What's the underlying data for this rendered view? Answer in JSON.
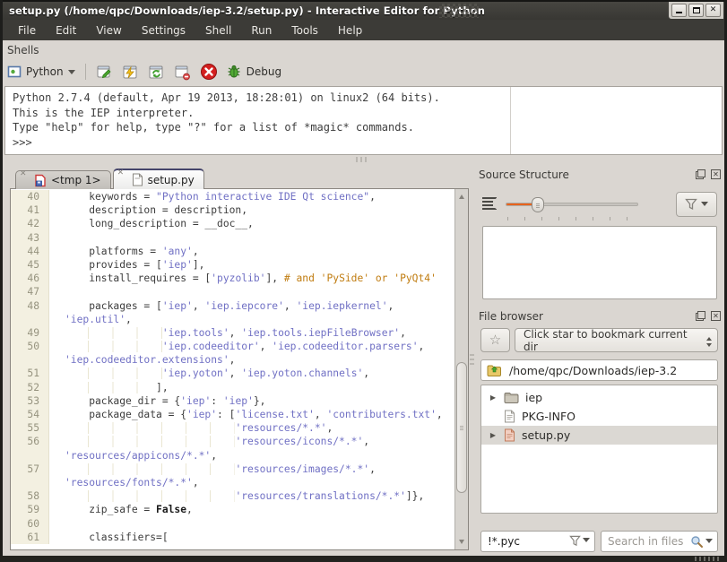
{
  "window": {
    "title": "setup.py (/home/qpc/Downloads/iep-3.2/setup.py) - Interactive Editor for Python",
    "controls": {
      "minimize": "minimize",
      "maximize": "maximize",
      "close": "x"
    }
  },
  "menu": {
    "items": [
      "File",
      "Edit",
      "View",
      "Settings",
      "Shell",
      "Run",
      "Tools",
      "Help"
    ]
  },
  "shells": {
    "label": "Shells",
    "toolbar": {
      "shell_button_label": "Python",
      "debug_label": "Debug"
    },
    "output_lines": [
      "Python 2.7.4 (default, Apr 19 2013, 18:28:01) on linux2 (64 bits).",
      "This is the IEP interpreter.",
      "Type \"help\" for help, type \"?\" for a list of *magic* commands.",
      ">>>"
    ]
  },
  "editor": {
    "tabs": [
      {
        "label": "<tmp 1>",
        "icon": "unsaved-file-icon",
        "active": false
      },
      {
        "label": "setup.py",
        "icon": "document-icon",
        "active": true
      }
    ],
    "lines": [
      {
        "n": "40",
        "s": [
          [
            "d",
            "    keywords = "
          ],
          [
            "s",
            "\"Python interactive IDE Qt science\""
          ],
          [
            "d",
            ","
          ]
        ]
      },
      {
        "n": "41",
        "s": [
          [
            "d",
            "    description = description,"
          ]
        ]
      },
      {
        "n": "42",
        "s": [
          [
            "d",
            "    long_description = __doc__,"
          ]
        ]
      },
      {
        "n": "43",
        "s": []
      },
      {
        "n": "44",
        "s": [
          [
            "d",
            "    platforms = "
          ],
          [
            "s",
            "'any'"
          ],
          [
            "d",
            ","
          ]
        ]
      },
      {
        "n": "45",
        "s": [
          [
            "d",
            "    provides = ["
          ],
          [
            "s",
            "'iep'"
          ],
          [
            "d",
            "],"
          ]
        ]
      },
      {
        "n": "46",
        "s": [
          [
            "d",
            "    install_requires = ["
          ],
          [
            "s",
            "'pyzolib'"
          ],
          [
            "d",
            "], "
          ],
          [
            "c",
            "# and 'PySide' or 'PyQt4'"
          ]
        ]
      },
      {
        "n": "47",
        "s": []
      },
      {
        "n": "48",
        "s": [
          [
            "d",
            "    packages = ["
          ],
          [
            "s",
            "'iep'"
          ],
          [
            "d",
            ", "
          ],
          [
            "s",
            "'iep.iepcore'"
          ],
          [
            "d",
            ", "
          ],
          [
            "s",
            "'iep.iepkernel'"
          ],
          [
            "d",
            ","
          ]
        ]
      },
      {
        "n": "",
        "s": [
          [
            "s",
            "'iep.util'"
          ],
          [
            "d",
            ","
          ]
        ]
      },
      {
        "n": "49",
        "s": [
          [
            "w",
            "                "
          ],
          [
            "s",
            "'iep.tools'"
          ],
          [
            "d",
            ", "
          ],
          [
            "s",
            "'iep.tools.iepFileBrowser'"
          ],
          [
            "d",
            ","
          ]
        ]
      },
      {
        "n": "50",
        "s": [
          [
            "w",
            "                "
          ],
          [
            "s",
            "'iep.codeeditor'"
          ],
          [
            "d",
            ", "
          ],
          [
            "s",
            "'iep.codeeditor.parsers'"
          ],
          [
            "d",
            ","
          ]
        ]
      },
      {
        "n": "",
        "s": [
          [
            "s",
            "'iep.codeeditor.extensions'"
          ],
          [
            "d",
            ","
          ]
        ]
      },
      {
        "n": "51",
        "s": [
          [
            "w",
            "                "
          ],
          [
            "s",
            "'iep.yoton'"
          ],
          [
            "d",
            ", "
          ],
          [
            "s",
            "'iep.yoton.channels'"
          ],
          [
            "d",
            ","
          ]
        ]
      },
      {
        "n": "52",
        "s": [
          [
            "w",
            "               "
          ],
          [
            "d",
            "],"
          ]
        ]
      },
      {
        "n": "53",
        "s": [
          [
            "d",
            "    package_dir = {"
          ],
          [
            "s",
            "'iep'"
          ],
          [
            "d",
            ": "
          ],
          [
            "s",
            "'iep'"
          ],
          [
            "d",
            "},"
          ]
        ]
      },
      {
        "n": "54",
        "s": [
          [
            "d",
            "    package_data = {"
          ],
          [
            "s",
            "'iep'"
          ],
          [
            "d",
            ": ["
          ],
          [
            "s",
            "'license.txt'"
          ],
          [
            "d",
            ", "
          ],
          [
            "s",
            "'contributers.txt'"
          ],
          [
            "d",
            ","
          ]
        ]
      },
      {
        "n": "55",
        "s": [
          [
            "w",
            "                            "
          ],
          [
            "s",
            "'resources/*.*'"
          ],
          [
            "d",
            ","
          ]
        ]
      },
      {
        "n": "56",
        "s": [
          [
            "w",
            "                            "
          ],
          [
            "s",
            "'resources/icons/*.*'"
          ],
          [
            "d",
            ","
          ]
        ]
      },
      {
        "n": "",
        "s": [
          [
            "s",
            "'resources/appicons/*.*'"
          ],
          [
            "d",
            ","
          ]
        ]
      },
      {
        "n": "57",
        "s": [
          [
            "w",
            "                            "
          ],
          [
            "s",
            "'resources/images/*.*'"
          ],
          [
            "d",
            ","
          ]
        ]
      },
      {
        "n": "",
        "s": [
          [
            "s",
            "'resources/fonts/*.*'"
          ],
          [
            "d",
            ","
          ]
        ]
      },
      {
        "n": "58",
        "s": [
          [
            "w",
            "                            "
          ],
          [
            "s",
            "'resources/translations/*.*'"
          ],
          [
            "d",
            "]},"
          ]
        ]
      },
      {
        "n": "59",
        "s": [
          [
            "d",
            "    zip_safe = "
          ],
          [
            "k",
            "False"
          ],
          [
            "d",
            ","
          ]
        ]
      },
      {
        "n": "60",
        "s": []
      },
      {
        "n": "61",
        "s": [
          [
            "d",
            "    classifiers=["
          ]
        ]
      }
    ]
  },
  "source_structure": {
    "title": "Source Structure"
  },
  "file_browser": {
    "title": "File browser",
    "bookmark_combo_text": "Click star to bookmark current dir",
    "path": "/home/qpc/Downloads/iep-3.2",
    "tree": [
      {
        "label": "iep",
        "icon": "folder-icon",
        "expandable": true,
        "selected": false
      },
      {
        "label": "PKG-INFO",
        "icon": "file-icon",
        "expandable": false,
        "selected": false
      },
      {
        "label": "setup.py",
        "icon": "python-file-icon",
        "expandable": true,
        "selected": true
      }
    ],
    "filter_value": "!*.pyc",
    "search_placeholder": "Search in files"
  },
  "colors": {
    "accent_orange": "#e8631c",
    "string_blue": "#7070c4",
    "comment_amber": "#c07c10",
    "titlebar_dark": "#3c3b37"
  }
}
